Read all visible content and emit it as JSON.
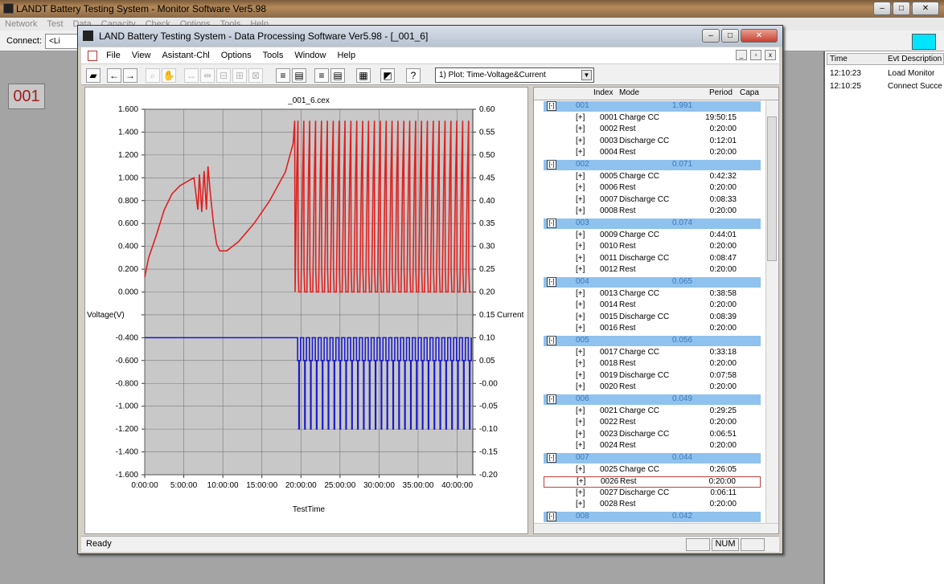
{
  "bg_window": {
    "title": "LANDT Battery Testing System - Monitor Software Ver5.98",
    "menu": [
      "Network",
      "Test",
      "Data",
      "Capacity",
      "Check",
      "Options",
      "Tools",
      "Help"
    ],
    "connect_label": "Connect:",
    "connect_value": "<Li",
    "channel_label": "001",
    "event_headers": [
      "Time",
      "Evt Description"
    ],
    "events": [
      {
        "time": "12:10:23",
        "desc": "Load Monitor"
      },
      {
        "time": "12:10:25",
        "desc": "Connect Succe"
      }
    ]
  },
  "window": {
    "title": "LAND Battery Testing System - Data Processing Software Ver5.98 - [_001_6]",
    "menu": [
      "File",
      "View",
      "Asistant-Chl",
      "Options",
      "Tools",
      "Window",
      "Help"
    ],
    "plot_select": "1) Plot: Time-Voltage&Current",
    "status_ready": "Ready",
    "status_num": "NUM"
  },
  "chart_data": {
    "type": "line",
    "title": "_001_6.cex",
    "xlabel": "TestTime",
    "ylabel_left": "Voltage(V)",
    "ylabel_right": "Current",
    "xlim": [
      0,
      42
    ],
    "ylim_left": [
      -1.6,
      1.6
    ],
    "ylim_right": [
      -0.2,
      0.6
    ],
    "x_ticks": [
      "0:00:00",
      "5:00:00",
      "10:00:00",
      "15:00:00",
      "20:00:00",
      "25:00:00",
      "30:00:00",
      "35:00:00",
      "40:00:00"
    ],
    "y_ticks_left": [
      "1.600",
      "1.400",
      "1.200",
      "1.000",
      "0.800",
      "0.600",
      "0.400",
      "0.200",
      "0.000",
      "",
      "-0.400",
      "-0.600",
      "-0.800",
      "-1.000",
      "-1.200",
      "-1.400",
      "-1.600"
    ],
    "y_ticks_right": [
      "0.60",
      "0.55",
      "0.50",
      "0.45",
      "0.40",
      "0.35",
      "0.30",
      "0.25",
      "0.20",
      "0.15",
      "0.10",
      "0.05",
      "-0.00",
      "-0.05",
      "-0.10",
      "-0.15",
      "-0.20"
    ],
    "grid": true,
    "series": [
      {
        "color": "#e02020",
        "points": [
          [
            0,
            0.13
          ],
          [
            0.5,
            0.3
          ],
          [
            1.5,
            0.5
          ],
          [
            2.5,
            0.72
          ],
          [
            3.5,
            0.86
          ],
          [
            4.5,
            0.93
          ],
          [
            5.5,
            0.97
          ],
          [
            6.3,
            1.0
          ],
          [
            6.8,
            0.72
          ],
          [
            7,
            1.03
          ],
          [
            7.3,
            0.7
          ],
          [
            7.6,
            1.06
          ],
          [
            7.9,
            0.72
          ],
          [
            8.1,
            1.1
          ],
          [
            8.4,
            0.86
          ],
          [
            8.8,
            0.6
          ],
          [
            9.2,
            0.42
          ],
          [
            9.6,
            0.36
          ],
          [
            10.5,
            0.36
          ],
          [
            12,
            0.44
          ],
          [
            14,
            0.6
          ],
          [
            16,
            0.8
          ],
          [
            18,
            1.05
          ],
          [
            19,
            1.3
          ],
          [
            19.2,
            1.5
          ]
        ]
      },
      {
        "color": "#1a1acc",
        "points": [
          [
            0,
            -0.4
          ],
          [
            19.2,
            -0.4
          ]
        ]
      }
    ],
    "cycles": {
      "start_h": 19.2,
      "end_h": 41.8,
      "count": 30,
      "voltage_high": 1.5,
      "voltage_low": 0.0,
      "current_charge": 0.1,
      "current_discharge": -0.1,
      "current_rest": 0.0
    }
  },
  "tree": {
    "headers": [
      "Index",
      "Mode",
      "Period",
      "Capa"
    ],
    "cycles": [
      {
        "num": "001",
        "cap": "1.991",
        "steps": [
          [
            "[+]",
            "0001",
            "Charge CC",
            "19:50:15"
          ],
          [
            "[+]",
            "0002",
            "Rest",
            "0:20:00"
          ],
          [
            "[+]",
            "0003",
            "Discharge CC",
            "0:12:01"
          ],
          [
            "[+]",
            "0004",
            "Rest",
            "0:20:00"
          ]
        ]
      },
      {
        "num": "002",
        "cap": "0.071",
        "steps": [
          [
            "[+]",
            "0005",
            "Charge CC",
            "0:42:32"
          ],
          [
            "[+]",
            "0006",
            "Rest",
            "0:20:00"
          ],
          [
            "[+]",
            "0007",
            "Discharge CC",
            "0:08:33"
          ],
          [
            "[+]",
            "0008",
            "Rest",
            "0:20:00"
          ]
        ]
      },
      {
        "num": "003",
        "cap": "0.074",
        "steps": [
          [
            "[+]",
            "0009",
            "Charge CC",
            "0:44:01"
          ],
          [
            "[+]",
            "0010",
            "Rest",
            "0:20:00"
          ],
          [
            "[+]",
            "0011",
            "Discharge CC",
            "0:08:47"
          ],
          [
            "[+]",
            "0012",
            "Rest",
            "0:20:00"
          ]
        ]
      },
      {
        "num": "004",
        "cap": "0.065",
        "steps": [
          [
            "[+]",
            "0013",
            "Charge CC",
            "0:38:58"
          ],
          [
            "[+]",
            "0014",
            "Rest",
            "0:20:00"
          ],
          [
            "[+]",
            "0015",
            "Discharge CC",
            "0:08:39"
          ],
          [
            "[+]",
            "0016",
            "Rest",
            "0:20:00"
          ]
        ]
      },
      {
        "num": "005",
        "cap": "0.056",
        "steps": [
          [
            "[+]",
            "0017",
            "Charge CC",
            "0:33:18"
          ],
          [
            "[+]",
            "0018",
            "Rest",
            "0:20:00"
          ],
          [
            "[+]",
            "0019",
            "Discharge CC",
            "0:07:58"
          ],
          [
            "[+]",
            "0020",
            "Rest",
            "0:20:00"
          ]
        ]
      },
      {
        "num": "006",
        "cap": "0.049",
        "steps": [
          [
            "[+]",
            "0021",
            "Charge CC",
            "0:29:25"
          ],
          [
            "[+]",
            "0022",
            "Rest",
            "0:20:00"
          ],
          [
            "[+]",
            "0023",
            "Discharge CC",
            "0:06:51"
          ],
          [
            "[+]",
            "0024",
            "Rest",
            "0:20:00"
          ]
        ]
      },
      {
        "num": "007",
        "cap": "0.044",
        "steps": [
          [
            "[+]",
            "0025",
            "Charge CC",
            "0:26:05"
          ],
          [
            "[+]",
            "0026",
            "Rest",
            "0:20:00"
          ],
          [
            "[+]",
            "0027",
            "Discharge CC",
            "0:06:11"
          ],
          [
            "[+]",
            "0028",
            "Rest",
            "0:20:00"
          ]
        ]
      },
      {
        "num": "008",
        "cap": "0.042",
        "steps": []
      }
    ],
    "selected_index": "0026"
  }
}
